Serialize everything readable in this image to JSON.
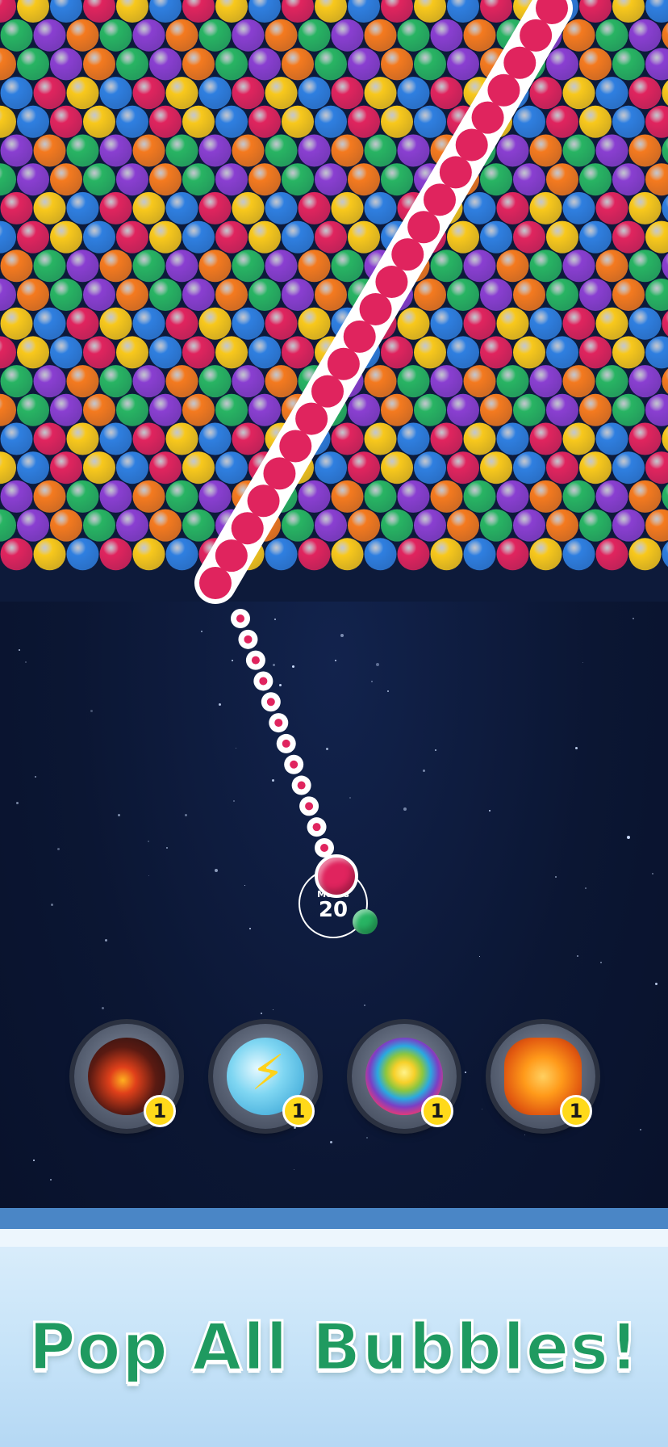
{
  "colors": {
    "red": "#e0245e",
    "orange": "#f47a1f",
    "yellow": "#f8c81c",
    "green": "#28b463",
    "blue": "#2f7fe0",
    "purple": "#8a3fd1",
    "path": "#ffffff",
    "background": "#0d1a3a",
    "headline": "#1f9a60"
  },
  "shooter": {
    "moves_label": "Moves",
    "moves_value": "20",
    "current_ball_color": "red",
    "next_ball_color": "green"
  },
  "boosters": [
    {
      "name": "bomb",
      "icon": "bomb-icon",
      "count": "1"
    },
    {
      "name": "lightning",
      "icon": "lightning-icon",
      "count": "1"
    },
    {
      "name": "rainbow",
      "icon": "rainbow-ball-icon",
      "count": "1"
    },
    {
      "name": "fire",
      "icon": "fireball-icon",
      "count": "1"
    }
  ],
  "banner": {
    "headline": "Pop All Bubbles!"
  }
}
